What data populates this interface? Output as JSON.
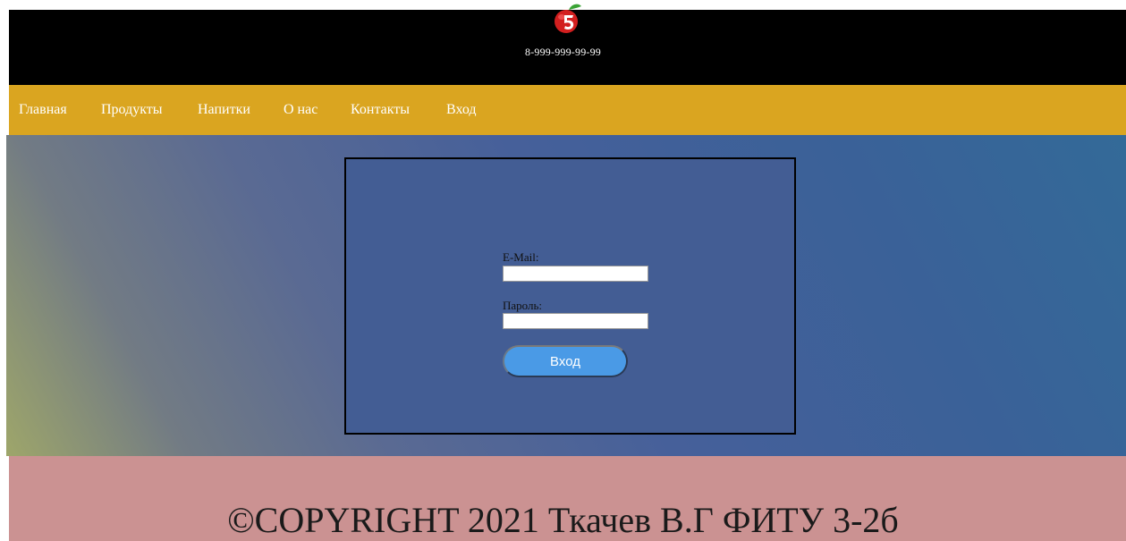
{
  "header": {
    "logo_icon": "apple-5-logo-icon",
    "phone": "8-999-999-99-99",
    "background": "#000000"
  },
  "nav": {
    "background": "#daa520",
    "items": [
      {
        "label": "Главная"
      },
      {
        "label": "Продукты"
      },
      {
        "label": "Напитки"
      },
      {
        "label": "О нас"
      },
      {
        "label": "Контакты"
      },
      {
        "label": "Вход"
      }
    ]
  },
  "login": {
    "email_label": "E-Mail:",
    "email_value": "",
    "password_label": "Пароль:",
    "password_value": "",
    "submit_label": "Вход",
    "button_color": "#4a9ae6"
  },
  "footer": {
    "copyright": "©COPYRIGHT 2021 Ткачев В.Г ФИТУ 3-2б",
    "background": "#cb9292"
  }
}
